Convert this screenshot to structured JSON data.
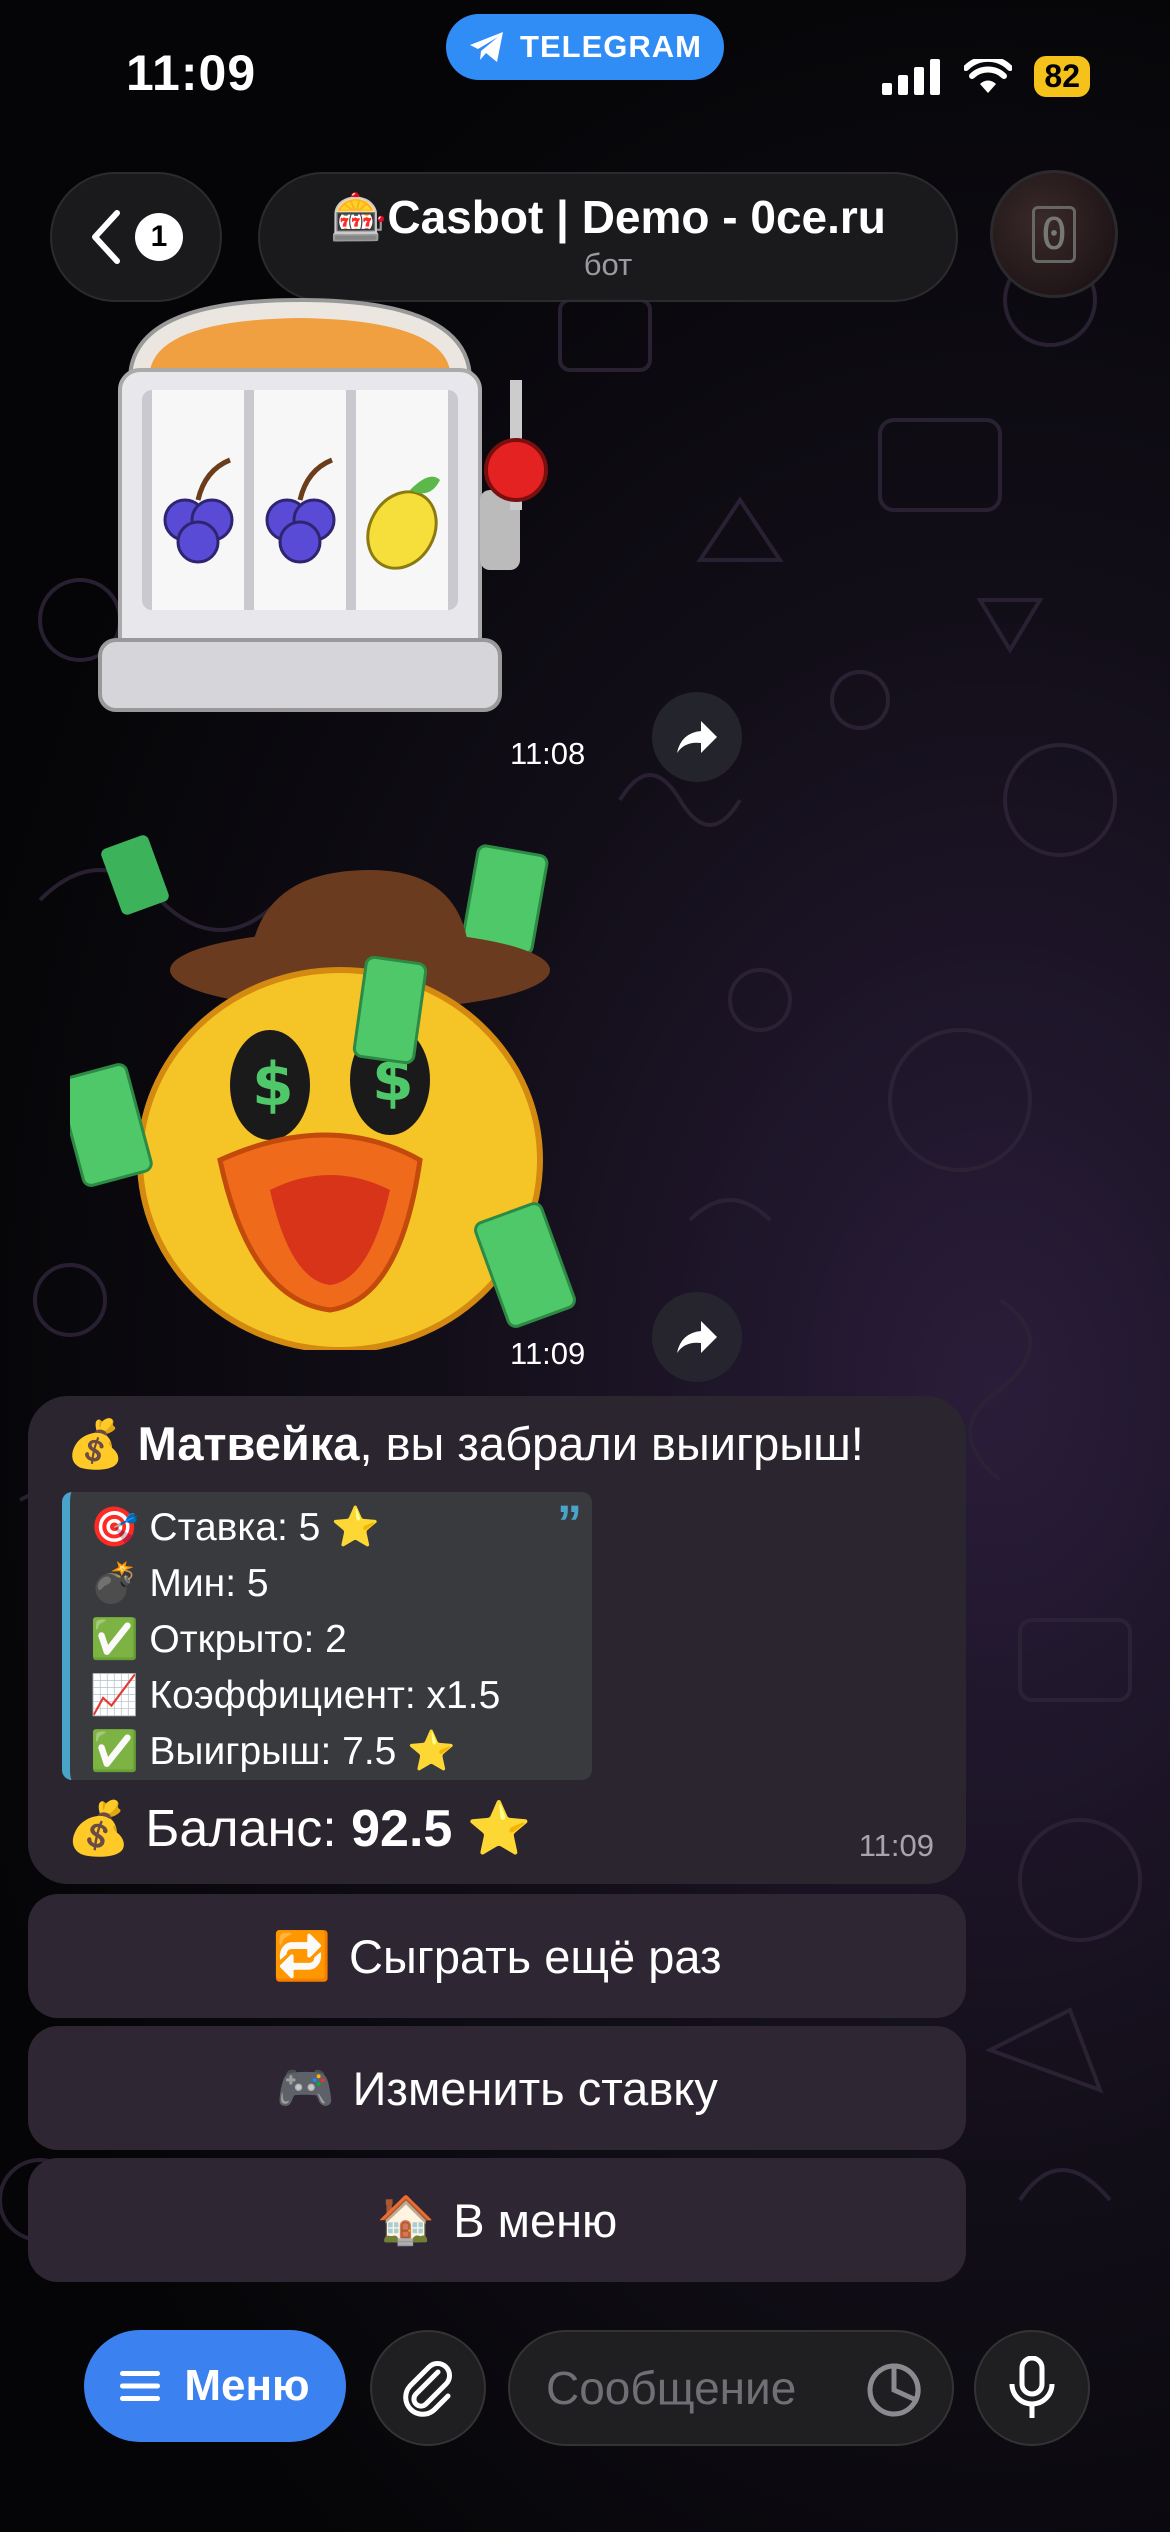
{
  "status_bar": {
    "time": "11:09",
    "pill_label": "TELEGRAM",
    "battery": "82"
  },
  "header": {
    "back_badge": "1",
    "title_emoji": "🎰",
    "title": "Casbot | Demo - 0ce.ru",
    "subtitle": "бот",
    "avatar_glyph": "0"
  },
  "messages": [
    {
      "type": "sticker",
      "sticker": "slot-machine",
      "time": "11:08"
    },
    {
      "type": "sticker",
      "sticker": "duck-money",
      "time": "11:09"
    }
  ],
  "result_message": {
    "icon": "💰",
    "name": "Матвейка",
    "text": ", вы забрали выигрыш!",
    "quote_lines": [
      {
        "icon": "🎯",
        "text": "Ставка: 5 ⭐"
      },
      {
        "icon": "💣",
        "text": "Мин: 5"
      },
      {
        "icon": "✅",
        "text": "Открыто: 2"
      },
      {
        "icon": "📈",
        "text": "Коэффициент: x1.5"
      },
      {
        "icon": "✅",
        "text": "Выигрыш: 7.5 ⭐"
      }
    ],
    "balance_label": "Баланс: ",
    "balance_value": "92.5",
    "balance_star": "⭐",
    "time": "11:09"
  },
  "keyboard": [
    {
      "icon": "🔁",
      "label": "Сыграть ещё раз"
    },
    {
      "icon": "🎮",
      "label": "Изменить ставку"
    },
    {
      "icon": "🏠",
      "label": "В меню"
    }
  ],
  "input_bar": {
    "menu_label": "Меню",
    "placeholder": "Сообщение"
  },
  "colors": {
    "accent_blue": "#3b82f0",
    "quote_bar": "#4aa3c8",
    "battery": "#f4c21a"
  }
}
